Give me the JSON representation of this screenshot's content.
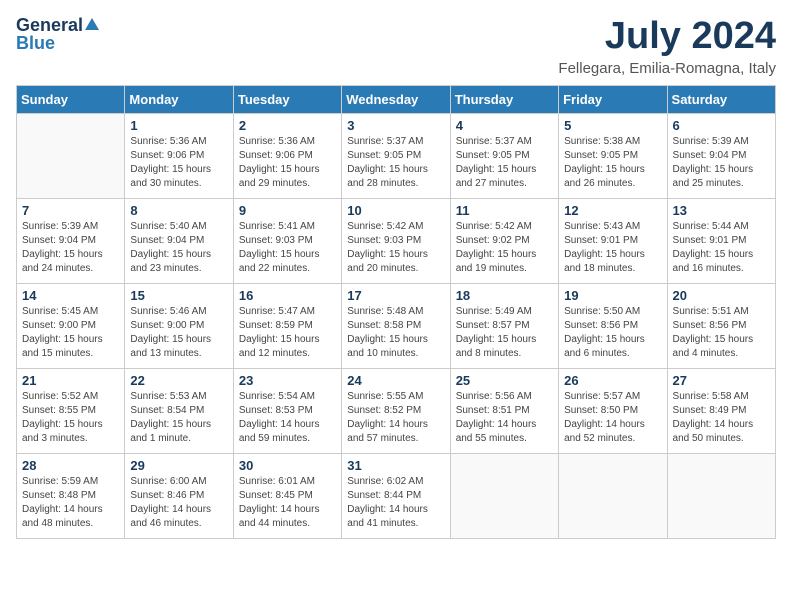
{
  "logo": {
    "general": "General",
    "blue": "Blue"
  },
  "title": "July 2024",
  "location": "Fellegara, Emilia-Romagna, Italy",
  "weekdays": [
    "Sunday",
    "Monday",
    "Tuesday",
    "Wednesday",
    "Thursday",
    "Friday",
    "Saturday"
  ],
  "weeks": [
    [
      {
        "day": "",
        "info": ""
      },
      {
        "day": "1",
        "info": "Sunrise: 5:36 AM\nSunset: 9:06 PM\nDaylight: 15 hours\nand 30 minutes."
      },
      {
        "day": "2",
        "info": "Sunrise: 5:36 AM\nSunset: 9:06 PM\nDaylight: 15 hours\nand 29 minutes."
      },
      {
        "day": "3",
        "info": "Sunrise: 5:37 AM\nSunset: 9:05 PM\nDaylight: 15 hours\nand 28 minutes."
      },
      {
        "day": "4",
        "info": "Sunrise: 5:37 AM\nSunset: 9:05 PM\nDaylight: 15 hours\nand 27 minutes."
      },
      {
        "day": "5",
        "info": "Sunrise: 5:38 AM\nSunset: 9:05 PM\nDaylight: 15 hours\nand 26 minutes."
      },
      {
        "day": "6",
        "info": "Sunrise: 5:39 AM\nSunset: 9:04 PM\nDaylight: 15 hours\nand 25 minutes."
      }
    ],
    [
      {
        "day": "7",
        "info": "Sunrise: 5:39 AM\nSunset: 9:04 PM\nDaylight: 15 hours\nand 24 minutes."
      },
      {
        "day": "8",
        "info": "Sunrise: 5:40 AM\nSunset: 9:04 PM\nDaylight: 15 hours\nand 23 minutes."
      },
      {
        "day": "9",
        "info": "Sunrise: 5:41 AM\nSunset: 9:03 PM\nDaylight: 15 hours\nand 22 minutes."
      },
      {
        "day": "10",
        "info": "Sunrise: 5:42 AM\nSunset: 9:03 PM\nDaylight: 15 hours\nand 20 minutes."
      },
      {
        "day": "11",
        "info": "Sunrise: 5:42 AM\nSunset: 9:02 PM\nDaylight: 15 hours\nand 19 minutes."
      },
      {
        "day": "12",
        "info": "Sunrise: 5:43 AM\nSunset: 9:01 PM\nDaylight: 15 hours\nand 18 minutes."
      },
      {
        "day": "13",
        "info": "Sunrise: 5:44 AM\nSunset: 9:01 PM\nDaylight: 15 hours\nand 16 minutes."
      }
    ],
    [
      {
        "day": "14",
        "info": "Sunrise: 5:45 AM\nSunset: 9:00 PM\nDaylight: 15 hours\nand 15 minutes."
      },
      {
        "day": "15",
        "info": "Sunrise: 5:46 AM\nSunset: 9:00 PM\nDaylight: 15 hours\nand 13 minutes."
      },
      {
        "day": "16",
        "info": "Sunrise: 5:47 AM\nSunset: 8:59 PM\nDaylight: 15 hours\nand 12 minutes."
      },
      {
        "day": "17",
        "info": "Sunrise: 5:48 AM\nSunset: 8:58 PM\nDaylight: 15 hours\nand 10 minutes."
      },
      {
        "day": "18",
        "info": "Sunrise: 5:49 AM\nSunset: 8:57 PM\nDaylight: 15 hours\nand 8 minutes."
      },
      {
        "day": "19",
        "info": "Sunrise: 5:50 AM\nSunset: 8:56 PM\nDaylight: 15 hours\nand 6 minutes."
      },
      {
        "day": "20",
        "info": "Sunrise: 5:51 AM\nSunset: 8:56 PM\nDaylight: 15 hours\nand 4 minutes."
      }
    ],
    [
      {
        "day": "21",
        "info": "Sunrise: 5:52 AM\nSunset: 8:55 PM\nDaylight: 15 hours\nand 3 minutes."
      },
      {
        "day": "22",
        "info": "Sunrise: 5:53 AM\nSunset: 8:54 PM\nDaylight: 15 hours\nand 1 minute."
      },
      {
        "day": "23",
        "info": "Sunrise: 5:54 AM\nSunset: 8:53 PM\nDaylight: 14 hours\nand 59 minutes."
      },
      {
        "day": "24",
        "info": "Sunrise: 5:55 AM\nSunset: 8:52 PM\nDaylight: 14 hours\nand 57 minutes."
      },
      {
        "day": "25",
        "info": "Sunrise: 5:56 AM\nSunset: 8:51 PM\nDaylight: 14 hours\nand 55 minutes."
      },
      {
        "day": "26",
        "info": "Sunrise: 5:57 AM\nSunset: 8:50 PM\nDaylight: 14 hours\nand 52 minutes."
      },
      {
        "day": "27",
        "info": "Sunrise: 5:58 AM\nSunset: 8:49 PM\nDaylight: 14 hours\nand 50 minutes."
      }
    ],
    [
      {
        "day": "28",
        "info": "Sunrise: 5:59 AM\nSunset: 8:48 PM\nDaylight: 14 hours\nand 48 minutes."
      },
      {
        "day": "29",
        "info": "Sunrise: 6:00 AM\nSunset: 8:46 PM\nDaylight: 14 hours\nand 46 minutes."
      },
      {
        "day": "30",
        "info": "Sunrise: 6:01 AM\nSunset: 8:45 PM\nDaylight: 14 hours\nand 44 minutes."
      },
      {
        "day": "31",
        "info": "Sunrise: 6:02 AM\nSunset: 8:44 PM\nDaylight: 14 hours\nand 41 minutes."
      },
      {
        "day": "",
        "info": ""
      },
      {
        "day": "",
        "info": ""
      },
      {
        "day": "",
        "info": ""
      }
    ]
  ]
}
